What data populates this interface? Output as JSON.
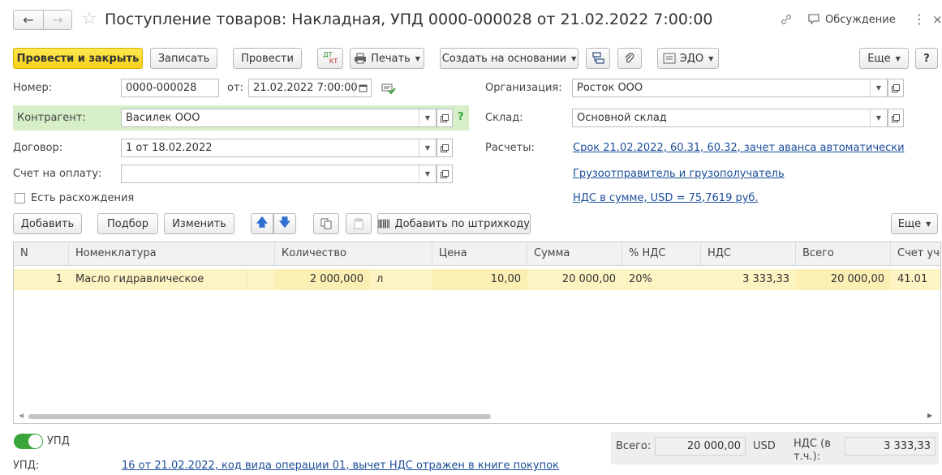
{
  "header": {
    "title": "Поступление товаров: Накладная, УПД 0000-000028 от 21.02.2022 7:00:00",
    "discussion_label": "Обсуждение"
  },
  "toolbar": {
    "post_close_label": "Провести и закрыть",
    "save_label": "Записать",
    "post_label": "Провести",
    "dtkt_label_top": "ДТ",
    "dtkt_label_bottom": "КТ",
    "print_label": "Печать",
    "create_based_label": "Создать на основании",
    "edo_label": "ЭДО",
    "more_label": "Еще",
    "help_label": "?"
  },
  "form": {
    "number_label": "Номер:",
    "number_value": "0000-000028",
    "from_label": "от:",
    "date_value": "21.02.2022  7:00:00",
    "org_label": "Организация:",
    "org_value": "Росток ООО",
    "counterparty_label": "Контрагент:",
    "counterparty_value": "Василек ООО",
    "warehouse_label": "Склад:",
    "warehouse_value": "Основной склад",
    "contract_label": "Договор:",
    "contract_value": "1 от 18.02.2022",
    "settlements_label": "Расчеты:",
    "settlements_link": "Срок 21.02.2022, 60.31, 60.32, зачет аванса автоматически",
    "invoice_label": "Счет на оплату:",
    "invoice_value": "",
    "shipper_link": "Грузоотправитель и грузополучатель",
    "discrepancy_label": "Есть расхождения",
    "vat_link": "НДС в сумме, USD = 75,7619 руб."
  },
  "table_toolbar": {
    "add_label": "Добавить",
    "pick_label": "Подбор",
    "edit_label": "Изменить",
    "barcode_label": "Добавить по штрихкоду",
    "more_label": "Еще"
  },
  "table": {
    "columns": [
      "N",
      "Номенклатура",
      "Количество",
      "Цена",
      "Сумма",
      "% НДС",
      "НДС",
      "Всего",
      "Счет уче"
    ],
    "rows": [
      {
        "n": "1",
        "item": "Масло гидравлическое",
        "qty": "2 000,000",
        "unit": "л",
        "price": "10,00",
        "sum": "20 000,00",
        "vat_rate": "20%",
        "vat": "3 333,33",
        "total": "20 000,00",
        "account": "41.01"
      }
    ]
  },
  "footer": {
    "upd_toggle_label": "УПД",
    "upd_label": "УПД:",
    "upd_link": "16 от 21.02.2022, код вида операции 01, вычет НДС отражен в книге покупок",
    "total_label": "Всего:",
    "total_value": "20 000,00",
    "currency": "USD",
    "vat_incl_label_1": "НДС (в",
    "vat_incl_label_2": "т.ч.):",
    "vat_incl_value": "3 333,33"
  },
  "colors": {
    "primary_button": "#f7d11a",
    "counterparty_highlight": "#d6efc9",
    "selected_row": "#fdf4c4",
    "link": "#1c4d9a",
    "toggle": "#3aa53a"
  }
}
